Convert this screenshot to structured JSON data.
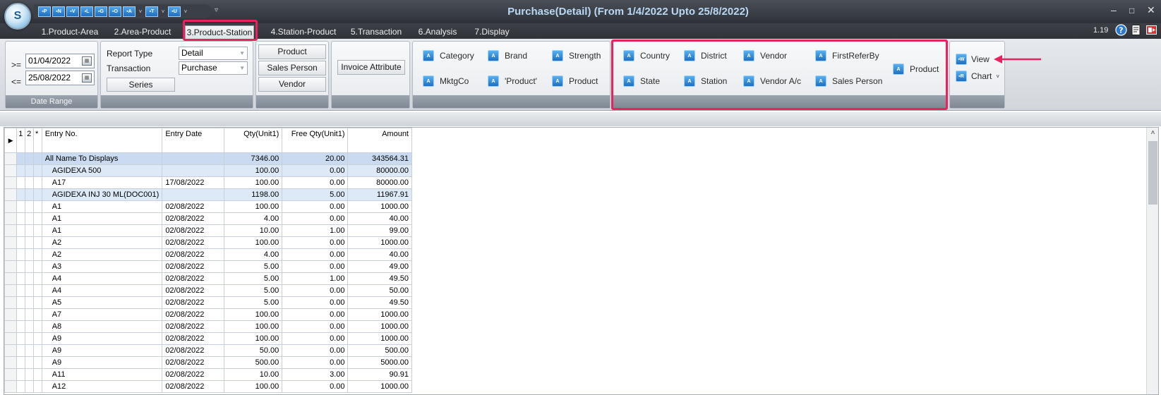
{
  "window": {
    "title": "Purchase(Detail) (From 1/4/2022 Upto 25/8/2022)",
    "logo_letter": "S",
    "minimize": "–",
    "maximize": "□",
    "close": "✕"
  },
  "quick_access": [
    {
      "label": "▪P",
      "icon": "p-icon"
    },
    {
      "label": "▪N",
      "icon": "n-icon"
    },
    {
      "label": "▪V",
      "icon": "v-icon"
    },
    {
      "label": "▪L",
      "icon": "l-icon"
    },
    {
      "label": "▪G",
      "icon": "g-icon"
    },
    {
      "label": "▪O",
      "icon": "o-icon"
    },
    {
      "label": "▪A",
      "icon": "a-icon",
      "dropdown": "˅"
    },
    {
      "label": "▪T",
      "icon": "t-icon",
      "dropdown": "˅"
    },
    {
      "label": "▪U",
      "icon": "u-icon",
      "dropdown": "˅"
    }
  ],
  "qat_more": "▿",
  "tabs": [
    "1.Product-Area",
    "2.Area-Product",
    "3.Product-Station",
    "4.Station-Product",
    "5.Transaction",
    "6.Analysis",
    "7.Display"
  ],
  "active_tab": 2,
  "version": "1.19",
  "date_range": {
    "from_op": ">=",
    "from": "01/04/2022",
    "to_op": "<=",
    "to": "25/08/2022",
    "footer": "Date Range"
  },
  "report": {
    "report_type_label": "Report Type",
    "report_type_value": "Detail",
    "transaction_label": "Transaction",
    "transaction_value": "Purchase",
    "series_button": "Series"
  },
  "filters": {
    "product": "Product",
    "sales_person": "Sales Person",
    "vendor": "Vendor",
    "invoice_attribute": "Invoice Attribute"
  },
  "product_group": [
    {
      "label": "Category",
      "icon": "category-icon"
    },
    {
      "label": "Brand",
      "icon": "brand-icon"
    },
    {
      "label": "Strength",
      "icon": "strength-icon"
    },
    {
      "label": "MktgCo",
      "icon": "mktgco-icon"
    },
    {
      "label": "'Product'",
      "icon": "product-quoted-icon"
    },
    {
      "label": "Product",
      "icon": "product-icon"
    }
  ],
  "station_group": [
    {
      "label": "Country",
      "icon": "country-icon"
    },
    {
      "label": "District",
      "icon": "district-icon"
    },
    {
      "label": "Vendor",
      "icon": "vendor-icon"
    },
    {
      "label": "FirstReferBy",
      "icon": "first-refer-by-icon"
    },
    {
      "label": "State",
      "icon": "state-icon"
    },
    {
      "label": "Station",
      "icon": "station-icon"
    },
    {
      "label": "Vendor A/c",
      "icon": "vendor-ac-icon"
    },
    {
      "label": "Sales Person",
      "icon": "sales-person-icon"
    },
    {
      "label": "Product",
      "icon": "product-icon"
    }
  ],
  "view_group": {
    "view": "View",
    "chart": "Chart",
    "chart_arrow": "˅"
  },
  "grid": {
    "row_marker": "▶",
    "columns": [
      "1",
      "2",
      "*",
      "Entry No.",
      "Entry Date",
      "Qty(Unit1)",
      "Free Qty(Unit1)",
      "Amount"
    ],
    "rows": [
      {
        "type": "total",
        "name": "All Name To Displays",
        "date": "",
        "qty": "7346.00",
        "free": "20.00",
        "amount": "343564.31"
      },
      {
        "type": "group",
        "name": "AGIDEXA 500",
        "date": "",
        "qty": "100.00",
        "free": "0.00",
        "amount": "80000.00"
      },
      {
        "type": "item",
        "name": "A17",
        "date": "17/08/2022",
        "qty": "100.00",
        "free": "0.00",
        "amount": "80000.00"
      },
      {
        "type": "group",
        "name": "AGIDEXA INJ 30 ML(DOC001)",
        "date": "",
        "qty": "1198.00",
        "free": "5.00",
        "amount": "11967.91"
      },
      {
        "type": "item",
        "name": "A1",
        "date": "02/08/2022",
        "qty": "100.00",
        "free": "0.00",
        "amount": "1000.00"
      },
      {
        "type": "item",
        "name": "A1",
        "date": "02/08/2022",
        "qty": "4.00",
        "free": "0.00",
        "amount": "40.00"
      },
      {
        "type": "item",
        "name": "A1",
        "date": "02/08/2022",
        "qty": "10.00",
        "free": "1.00",
        "amount": "99.00"
      },
      {
        "type": "item",
        "name": "A2",
        "date": "02/08/2022",
        "qty": "100.00",
        "free": "0.00",
        "amount": "1000.00"
      },
      {
        "type": "item",
        "name": "A2",
        "date": "02/08/2022",
        "qty": "4.00",
        "free": "0.00",
        "amount": "40.00"
      },
      {
        "type": "item",
        "name": "A3",
        "date": "02/08/2022",
        "qty": "5.00",
        "free": "0.00",
        "amount": "49.00"
      },
      {
        "type": "item",
        "name": "A4",
        "date": "02/08/2022",
        "qty": "5.00",
        "free": "1.00",
        "amount": "49.50"
      },
      {
        "type": "item",
        "name": "A4",
        "date": "02/08/2022",
        "qty": "5.00",
        "free": "0.00",
        "amount": "50.00"
      },
      {
        "type": "item",
        "name": "A5",
        "date": "02/08/2022",
        "qty": "5.00",
        "free": "0.00",
        "amount": "49.50"
      },
      {
        "type": "item",
        "name": "A7",
        "date": "02/08/2022",
        "qty": "100.00",
        "free": "0.00",
        "amount": "1000.00"
      },
      {
        "type": "item",
        "name": "A8",
        "date": "02/08/2022",
        "qty": "100.00",
        "free": "0.00",
        "amount": "1000.00"
      },
      {
        "type": "item",
        "name": "A9",
        "date": "02/08/2022",
        "qty": "100.00",
        "free": "0.00",
        "amount": "1000.00"
      },
      {
        "type": "item",
        "name": "A9",
        "date": "02/08/2022",
        "qty": "50.00",
        "free": "0.00",
        "amount": "500.00"
      },
      {
        "type": "item",
        "name": "A9",
        "date": "02/08/2022",
        "qty": "500.00",
        "free": "0.00",
        "amount": "5000.00"
      },
      {
        "type": "item",
        "name": "A11",
        "date": "02/08/2022",
        "qty": "10.00",
        "free": "3.00",
        "amount": "90.91"
      },
      {
        "type": "item",
        "name": "A12",
        "date": "02/08/2022",
        "qty": "100.00",
        "free": "0.00",
        "amount": "1000.00"
      }
    ]
  },
  "scroll_up": "˄",
  "colors": {
    "accent_highlight": "#e8245e",
    "title_text": "#b9d7f3",
    "total_row": "#c9daf1",
    "group_row": "#dde9f7"
  }
}
